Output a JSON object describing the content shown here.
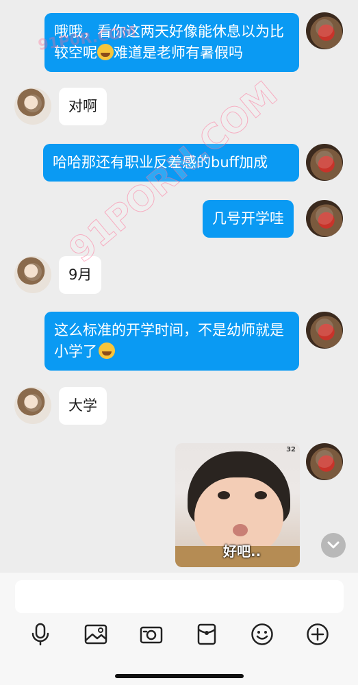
{
  "messages": [
    {
      "side": "out",
      "text": "哦哦，看你这两天好像能休息以为比较空呢",
      "emoji": "grin-sweat-emoji",
      "text_after": "难道是老师有暑假吗"
    },
    {
      "side": "in",
      "text": "对啊"
    },
    {
      "side": "out",
      "text": "哈哈那还有职业反差感的buff加成"
    },
    {
      "side": "out",
      "text": "几号开学哇"
    },
    {
      "side": "in",
      "text": "9月"
    },
    {
      "side": "out",
      "text": "这么标准的开学时间，不是幼师就是小学了",
      "emoji": "thinking-emoji"
    },
    {
      "side": "in",
      "text": "大学"
    },
    {
      "side": "out",
      "type": "sticker",
      "caption": "好吧..",
      "tag": "32"
    }
  ],
  "watermarks": [
    "91P0R.COM",
    "91PORN.COM"
  ],
  "input": {
    "placeholder": ""
  },
  "toolbar": [
    {
      "icon": "microphone-icon"
    },
    {
      "icon": "image-icon"
    },
    {
      "icon": "camera-icon"
    },
    {
      "icon": "red-packet-icon"
    },
    {
      "icon": "smiley-icon"
    },
    {
      "icon": "plus-icon"
    }
  ],
  "colors": {
    "outgoing_bubble": "#0a9af3",
    "incoming_bubble": "#ffffff",
    "background": "#ededed"
  }
}
